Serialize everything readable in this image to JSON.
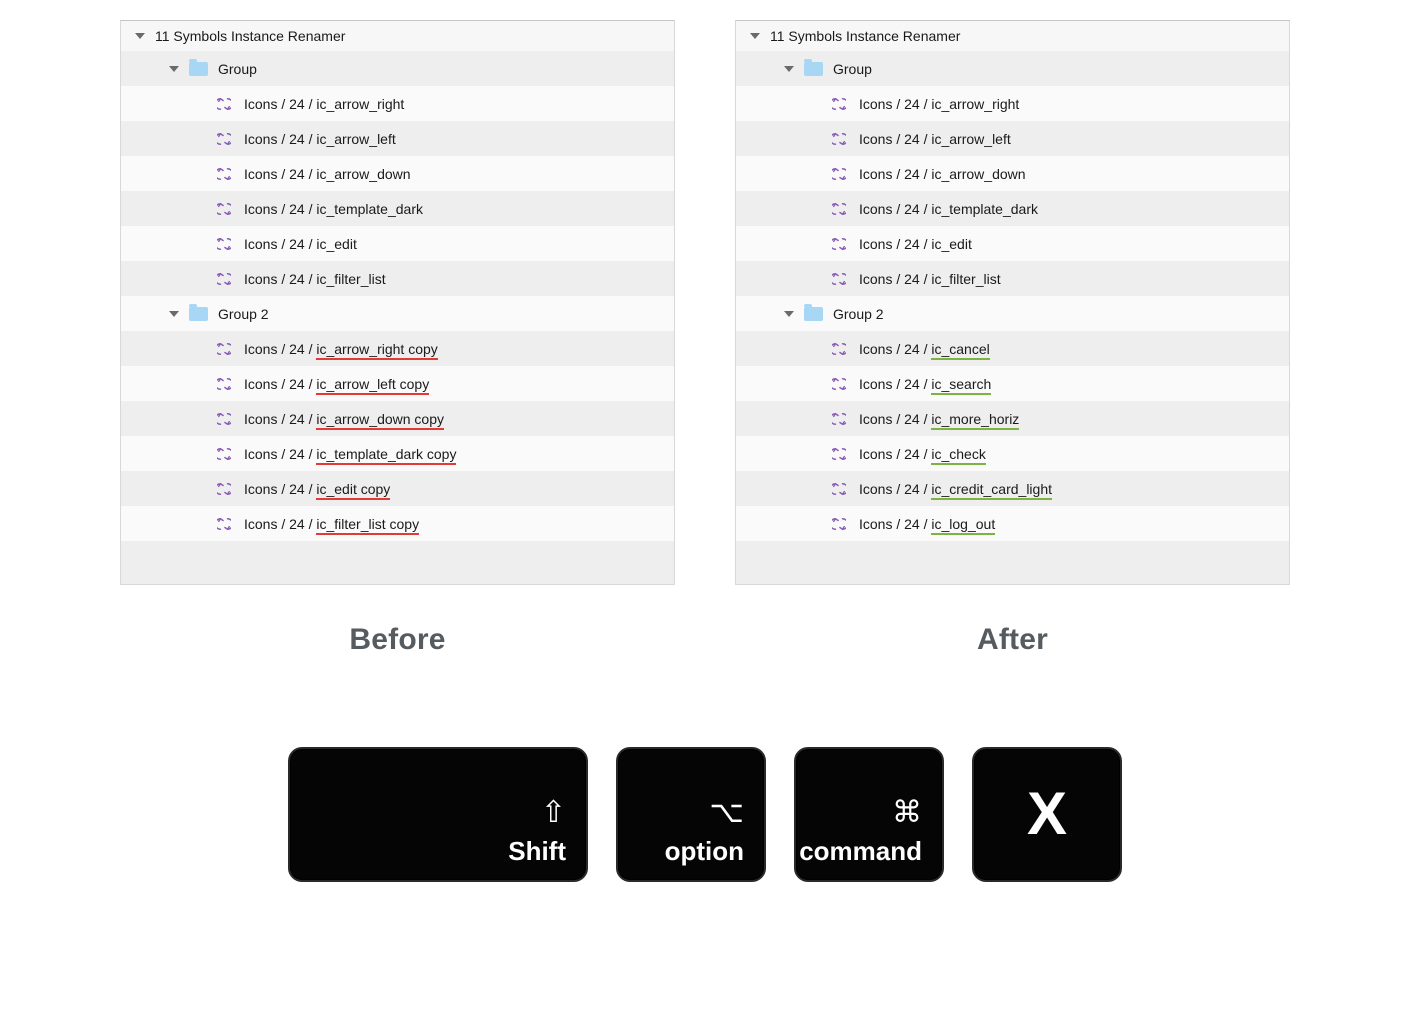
{
  "panels": {
    "before": {
      "title": "11 Symbols Instance Renamer",
      "caption": "Before",
      "groups": [
        {
          "name": "Group",
          "layers": [
            {
              "prefix": "Icons / 24 / ",
              "name": "ic_arrow_right",
              "underline": null
            },
            {
              "prefix": "Icons / 24 / ",
              "name": "ic_arrow_left",
              "underline": null
            },
            {
              "prefix": "Icons / 24 / ",
              "name": "ic_arrow_down",
              "underline": null
            },
            {
              "prefix": "Icons / 24 / ",
              "name": "ic_template_dark",
              "underline": null
            },
            {
              "prefix": "Icons / 24 / ",
              "name": "ic_edit",
              "underline": null
            },
            {
              "prefix": "Icons / 24 / ",
              "name": "ic_filter_list",
              "underline": null
            }
          ]
        },
        {
          "name": "Group 2",
          "layers": [
            {
              "prefix": "Icons / 24 / ",
              "name": "ic_arrow_right copy",
              "underline": "red"
            },
            {
              "prefix": "Icons / 24 / ",
              "name": "ic_arrow_left copy",
              "underline": "red"
            },
            {
              "prefix": "Icons / 24 / ",
              "name": "ic_arrow_down copy",
              "underline": "red"
            },
            {
              "prefix": "Icons / 24 / ",
              "name": "ic_template_dark copy",
              "underline": "red"
            },
            {
              "prefix": "Icons / 24 / ",
              "name": "ic_edit copy",
              "underline": "red"
            },
            {
              "prefix": "Icons / 24 / ",
              "name": "ic_filter_list copy",
              "underline": "red"
            }
          ]
        }
      ]
    },
    "after": {
      "title": "11 Symbols Instance Renamer",
      "caption": "After",
      "groups": [
        {
          "name": "Group",
          "layers": [
            {
              "prefix": "Icons / 24 / ",
              "name": "ic_arrow_right",
              "underline": null
            },
            {
              "prefix": "Icons / 24 / ",
              "name": "ic_arrow_left",
              "underline": null
            },
            {
              "prefix": "Icons / 24 / ",
              "name": "ic_arrow_down",
              "underline": null
            },
            {
              "prefix": "Icons / 24 / ",
              "name": "ic_template_dark",
              "underline": null
            },
            {
              "prefix": "Icons / 24 / ",
              "name": "ic_edit",
              "underline": null
            },
            {
              "prefix": "Icons / 24 / ",
              "name": "ic_filter_list",
              "underline": null
            }
          ]
        },
        {
          "name": "Group 2",
          "layers": [
            {
              "prefix": "Icons / 24 / ",
              "name": "ic_cancel",
              "underline": "green"
            },
            {
              "prefix": "Icons / 24 / ",
              "name": "ic_search",
              "underline": "green"
            },
            {
              "prefix": "Icons / 24 / ",
              "name": "ic_more_horiz",
              "underline": "green"
            },
            {
              "prefix": "Icons / 24 / ",
              "name": "ic_check",
              "underline": "green"
            },
            {
              "prefix": "Icons / 24 / ",
              "name": "ic_credit_card_light",
              "underline": "green"
            },
            {
              "prefix": "Icons / 24 / ",
              "name": "ic_log_out",
              "underline": "green"
            }
          ]
        }
      ]
    }
  },
  "keys": {
    "shift": {
      "glyph": "⇧",
      "label": "Shift"
    },
    "option": {
      "glyph": "⌥",
      "label": "option"
    },
    "command": {
      "glyph": "⌘",
      "label": "command"
    },
    "x": {
      "glyph": "X"
    }
  }
}
